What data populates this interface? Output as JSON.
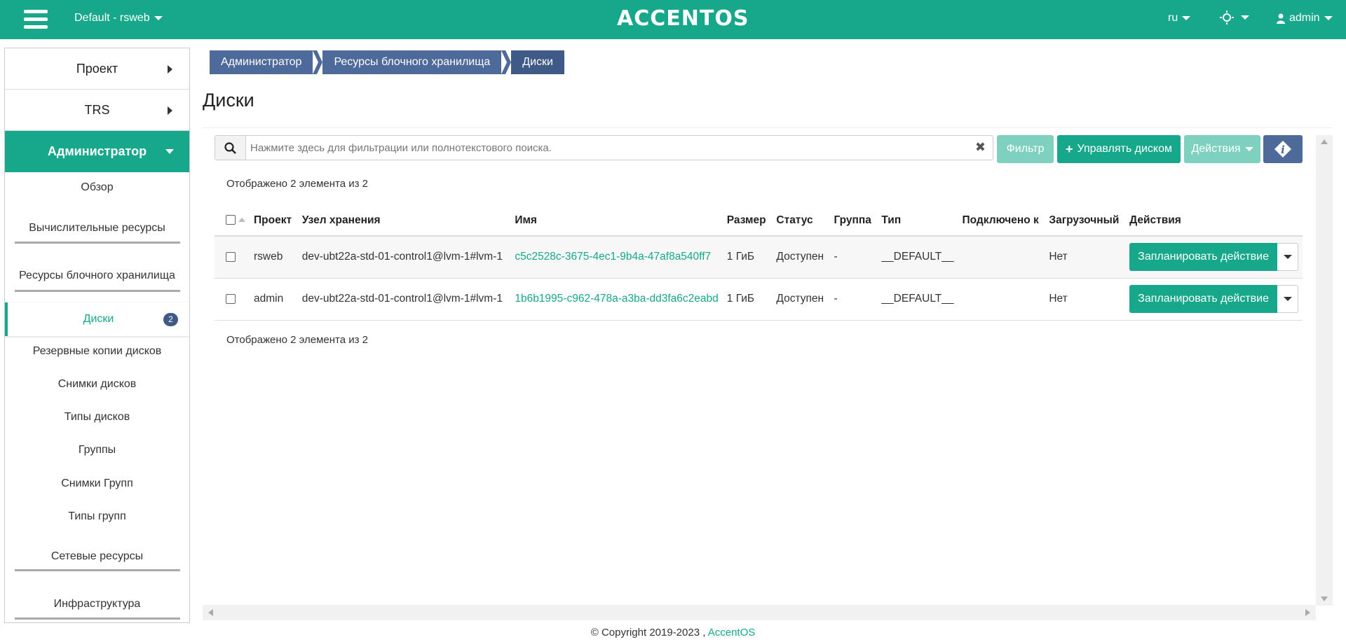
{
  "header": {
    "project_selector": "Default - rsweb",
    "logo": "ACCENTOS",
    "language": "ru",
    "user": "admin"
  },
  "sidebar": {
    "sections": [
      "Проект",
      "TRS",
      "Администратор"
    ],
    "items": [
      "Обзор",
      "Вычислительные ресурсы",
      "Ресурсы блочного хранилища",
      "Диски",
      "Резервные копии дисков",
      "Снимки дисков",
      "Типы дисков",
      "Группы",
      "Снимки Групп",
      "Типы групп",
      "Сетевые ресурсы",
      "Инфраструктура"
    ],
    "current_badge": "2"
  },
  "breadcrumb": [
    "Администратор",
    "Ресурсы блочного хранилища",
    "Диски"
  ],
  "page_title": "Диски",
  "search": {
    "placeholder": "Нажмите здесь для фильтрации или полнотекстового поиска."
  },
  "toolbar": {
    "filter_label": "Фильтр",
    "manage_label": "Управлять диском",
    "actions_label": "Действия"
  },
  "count_text": "Отображено 2 элемента из 2",
  "table": {
    "columns": [
      "Проект",
      "Узел хранения",
      "Имя",
      "Размер",
      "Статус",
      "Группа",
      "Тип",
      "Подключено к",
      "Загрузочный",
      "Действия"
    ],
    "rows": [
      {
        "project": "rsweb",
        "host": "dev-ubt22a-std-01-control1@lvm-1#lvm-1",
        "name": "c5c2528c-3675-4ec1-9b4a-47af8a540ff7",
        "size": "1 ГиБ",
        "status": "Доступен",
        "group": "-",
        "type": "__DEFAULT__",
        "attached": "",
        "bootable": "Нет",
        "action": "Запланировать действие"
      },
      {
        "project": "admin",
        "host": "dev-ubt22a-std-01-control1@lvm-1#lvm-1",
        "name": "1b6b1995-c962-478a-a3ba-dd3fa6c2eabd",
        "size": "1 ГиБ",
        "status": "Доступен",
        "group": "-",
        "type": "__DEFAULT__",
        "attached": "",
        "bootable": "Нет",
        "action": "Запланировать действие"
      }
    ]
  },
  "footer": {
    "copyright": "© Copyright 2019-2023 ,",
    "link": "AccentOS"
  }
}
